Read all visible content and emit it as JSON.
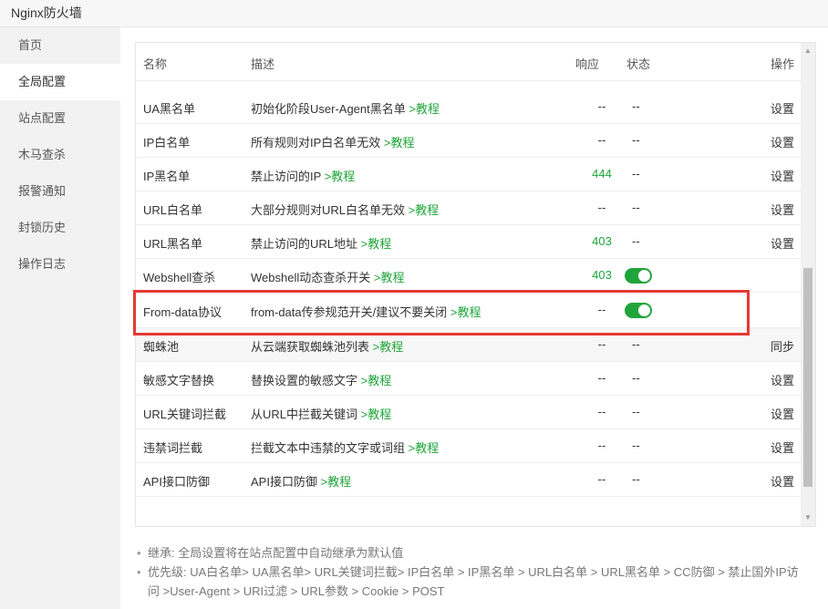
{
  "window": {
    "title": "Nginx防火墙"
  },
  "sidebar": {
    "items": [
      {
        "label": "首页"
      },
      {
        "label": "全局配置"
      },
      {
        "label": "站点配置"
      },
      {
        "label": "木马查杀"
      },
      {
        "label": "报警通知"
      },
      {
        "label": "封锁历史"
      },
      {
        "label": "操作日志"
      }
    ]
  },
  "table": {
    "headers": {
      "name": "名称",
      "desc": "描述",
      "resp": "响应",
      "status": "状态",
      "action": "操作"
    },
    "tutorial_label": ">教程",
    "rows": [
      {
        "name": "UA黑名单",
        "desc": "初始化阶段User-Agent黑名单",
        "resp": "--",
        "status": "--",
        "action": "设置"
      },
      {
        "name": "IP白名单",
        "desc": "所有规则对IP白名单无效",
        "resp": "--",
        "status": "--",
        "action": "设置"
      },
      {
        "name": "IP黑名单",
        "desc": "禁止访问的IP",
        "resp": "444",
        "status": "--",
        "action": "设置"
      },
      {
        "name": "URL白名单",
        "desc": "大部分规则对URL白名单无效",
        "resp": "--",
        "status": "--",
        "action": "设置"
      },
      {
        "name": "URL黑名单",
        "desc": "禁止访问的URL地址",
        "resp": "403",
        "status": "--",
        "action": "设置"
      },
      {
        "name": "Webshell查杀",
        "desc": "Webshell动态查杀开关",
        "resp": "403",
        "status": "on",
        "action": ""
      },
      {
        "name": "From-data协议",
        "desc": "from-data传参规范开关/建议不要关闭",
        "resp": "--",
        "status": "on",
        "action": ""
      },
      {
        "name": "蜘蛛池",
        "desc": "从云端获取蜘蛛池列表",
        "resp": "--",
        "status": "--",
        "action": "同步"
      },
      {
        "name": "敏感文字替换",
        "desc": "替换设置的敏感文字",
        "resp": "--",
        "status": "--",
        "action": "设置"
      },
      {
        "name": "URL关键词拦截",
        "desc": "从URL中拦截关键词",
        "resp": "--",
        "status": "--",
        "action": "设置"
      },
      {
        "name": "违禁词拦截",
        "desc": "拦截文本中违禁的文字或词组",
        "resp": "--",
        "status": "--",
        "action": "设置"
      },
      {
        "name": "API接口防御",
        "desc": "API接口防御",
        "resp": "--",
        "status": "--",
        "action": "设置"
      }
    ]
  },
  "notes": [
    "继承: 全局设置将在站点配置中自动继承为默认值",
    "优先级: UA白名单> UA黑名单> URL关键词拦截> IP白名单 > IP黑名单 > URL白名单 > URL黑名单 > CC防御 > 禁止国外IP访问 >User-Agent > URI过滤 > URL参数 > Cookie > POST"
  ],
  "colors": {
    "accent": "#20a53a",
    "highlight": "#e53935"
  }
}
